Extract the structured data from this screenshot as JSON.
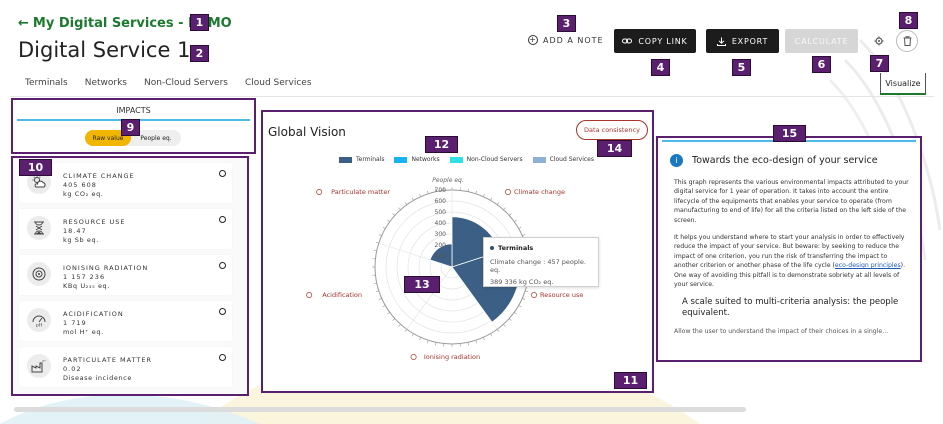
{
  "header": {
    "back_label": "My Digital Services - DEMO",
    "title": "Digital Service 1",
    "add_note": "ADD A NOTE",
    "copy_link": "COPY LINK",
    "export": "EXPORT",
    "calculate": "CALCULATE",
    "visualize": "Visualize"
  },
  "tabs": [
    "Terminals",
    "Networks",
    "Non-Cloud Servers",
    "Cloud Services"
  ],
  "badges": [
    "1",
    "2",
    "3",
    "4",
    "5",
    "6",
    "7",
    "8",
    "9",
    "10",
    "11",
    "12",
    "13",
    "14",
    "15"
  ],
  "impacts": {
    "title": "IMPACTS",
    "toggle_on": "Raw value",
    "toggle_off": "People eq.",
    "items": [
      {
        "name": "CLIMATE CHANGE",
        "value": "405 608",
        "unit": "kg CO₂ eq.",
        "icon": "cloud-sun-icon"
      },
      {
        "name": "RESOURCE USE",
        "value": "18.47",
        "unit": "kg Sb eq.",
        "icon": "hourglass-icon"
      },
      {
        "name": "IONISING RADIATION",
        "value": "1 157 236",
        "unit": "KBq U₂₃₅ eq.",
        "icon": "radiation-icon"
      },
      {
        "name": "ACIDIFICATION",
        "value": "1 719",
        "unit": "mol H⁺ eq.",
        "icon": "ph-gauge-icon"
      },
      {
        "name": "PARTICULATE MATTER",
        "value": "0.02",
        "unit": "Disease incidence",
        "icon": "factory-icon"
      }
    ]
  },
  "chart": {
    "title": "Global Vision",
    "consistency": "Data consistency",
    "tooltip_title": "Terminals",
    "tooltip_line1": "Climate change : 457 people. eq.",
    "tooltip_line2": "389 336 kg CO₂ eq.",
    "colors": {
      "Terminals": "#3b5f85",
      "Networks": "#19b4f0",
      "Non-Cloud Servers": "#2fe0e8",
      "Cloud Services": "#8fb0d6"
    }
  },
  "chart_data": {
    "type": "polar-bar",
    "radial_label": "People eq.",
    "radial_ticks": [
      100,
      200,
      300,
      400,
      500,
      600,
      700
    ],
    "rmax": 700,
    "categories": [
      "Climate change",
      "Resource use",
      "Ionising radiation",
      "Acidification",
      "Particulate matter"
    ],
    "series": [
      {
        "name": "Terminals",
        "values": [
          457,
          620,
          0,
          10,
          210
        ]
      },
      {
        "name": "Networks",
        "values": [
          0,
          0,
          0,
          0,
          0
        ]
      },
      {
        "name": "Non-Cloud Servers",
        "values": [
          0,
          0,
          0,
          0,
          0
        ]
      },
      {
        "name": "Cloud Services",
        "values": [
          0,
          0,
          0,
          0,
          0
        ]
      }
    ]
  },
  "info": {
    "title": "Towards the eco-design of your service",
    "p1": "This graph represents the various environmental impacts attributed to your digital service for 1 year of operation. It takes into account the entire lifecycle of the equipments that enables your service to operate (from manufacturing to end of life) for all the criteria listed on the left side of the screen.",
    "p2_before": "It helps you understand where to start your analysis in order to effectively reduce the impact of your service. But beware: by seeking to reduce the impact of one criterion, you run the risk of transferring the impact to another criterion or another phase of the life cycle (",
    "p2_link": "eco-design principles",
    "p2_after": "). One way of avoiding this pitfall is to demonstrate sobriety at all levels of your service.",
    "subtitle": "A scale suited to multi-criteria analysis: the people equivalent.",
    "cut": "Allow the user to understand the impact of their choices in a single..."
  }
}
